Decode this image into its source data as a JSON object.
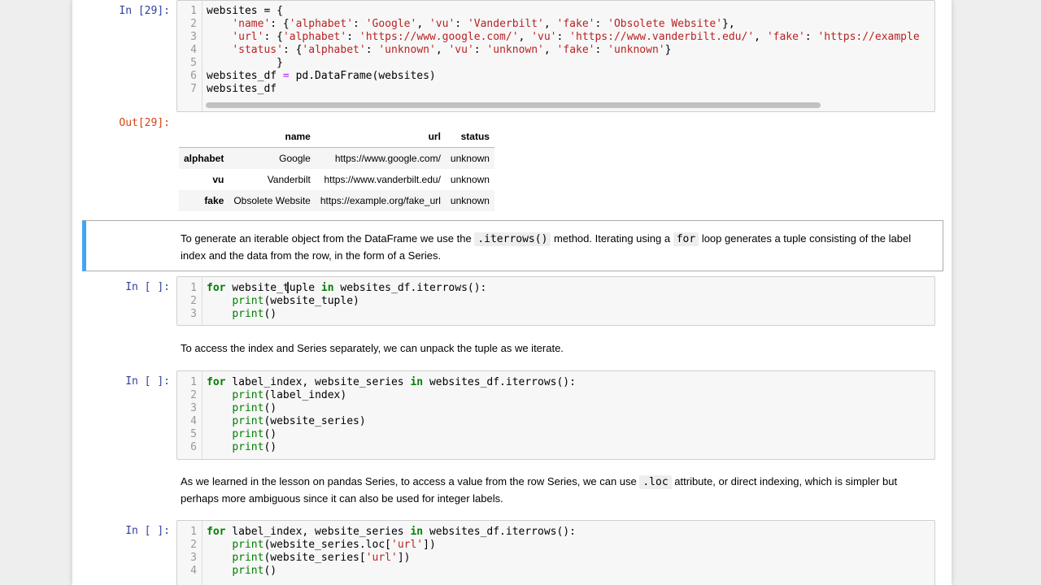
{
  "cells": {
    "c29": {
      "prompt": "In [29]:",
      "lines": [
        [
          [
            "plain",
            "websites = {"
          ]
        ],
        [
          [
            "plain",
            "    "
          ],
          [
            "str",
            "'name'"
          ],
          [
            "plain",
            ": {"
          ],
          [
            "str",
            "'alphabet'"
          ],
          [
            "plain",
            ": "
          ],
          [
            "str",
            "'Google'"
          ],
          [
            "plain",
            ", "
          ],
          [
            "str",
            "'vu'"
          ],
          [
            "plain",
            ": "
          ],
          [
            "str",
            "'Vanderbilt'"
          ],
          [
            "plain",
            ", "
          ],
          [
            "str",
            "'fake'"
          ],
          [
            "plain",
            ": "
          ],
          [
            "str",
            "'Obsolete Website'"
          ],
          [
            "plain",
            "},"
          ]
        ],
        [
          [
            "plain",
            "    "
          ],
          [
            "str",
            "'url'"
          ],
          [
            "plain",
            ": {"
          ],
          [
            "str",
            "'alphabet'"
          ],
          [
            "plain",
            ": "
          ],
          [
            "str",
            "'https://www.google.com/'"
          ],
          [
            "plain",
            ", "
          ],
          [
            "str",
            "'vu'"
          ],
          [
            "plain",
            ": "
          ],
          [
            "str",
            "'https://www.vanderbilt.edu/'"
          ],
          [
            "plain",
            ", "
          ],
          [
            "str",
            "'fake'"
          ],
          [
            "plain",
            ": "
          ],
          [
            "str",
            "'https://example"
          ]
        ],
        [
          [
            "plain",
            "    "
          ],
          [
            "str",
            "'status'"
          ],
          [
            "plain",
            ": {"
          ],
          [
            "str",
            "'alphabet'"
          ],
          [
            "plain",
            ": "
          ],
          [
            "str",
            "'unknown'"
          ],
          [
            "plain",
            ", "
          ],
          [
            "str",
            "'vu'"
          ],
          [
            "plain",
            ": "
          ],
          [
            "str",
            "'unknown'"
          ],
          [
            "plain",
            ", "
          ],
          [
            "str",
            "'fake'"
          ],
          [
            "plain",
            ": "
          ],
          [
            "str",
            "'unknown'"
          ],
          [
            "plain",
            "}"
          ]
        ],
        [
          [
            "plain",
            "           }"
          ]
        ],
        [
          [
            "plain",
            "websites_df "
          ],
          [
            "op",
            "="
          ],
          [
            "plain",
            " pd.DataFrame(websites)"
          ]
        ],
        [
          [
            "plain",
            "websites_df"
          ]
        ]
      ]
    },
    "out29": {
      "prompt": "Out[29]:",
      "columns": [
        "name",
        "url",
        "status"
      ],
      "rows": [
        {
          "index": "alphabet",
          "values": [
            "Google",
            "https://www.google.com/",
            "unknown"
          ]
        },
        {
          "index": "vu",
          "values": [
            "Vanderbilt",
            "https://www.vanderbilt.edu/",
            "unknown"
          ]
        },
        {
          "index": "fake",
          "values": [
            "Obsolete Website",
            "https://example.org/fake_url",
            "unknown"
          ]
        }
      ]
    },
    "md1": {
      "t1": "To generate an iterable object from the DataFrame we use the ",
      "c1": ".iterrows()",
      "t2": " method. Iterating using a ",
      "c2": "for",
      "t3": " loop generates a tuple consisting of the label index and the data from the row, in the form of a Series."
    },
    "c30": {
      "prompt": "In [ ]:",
      "lines": [
        [
          [
            "kw",
            "for"
          ],
          [
            "plain",
            " website_tuple "
          ],
          [
            "kw",
            "in"
          ],
          [
            "plain",
            " websites_df.iterrows():"
          ]
        ],
        [
          [
            "plain",
            "    "
          ],
          [
            "bi",
            "print"
          ],
          [
            "plain",
            "(website_tuple)"
          ]
        ],
        [
          [
            "plain",
            "    "
          ],
          [
            "bi",
            "print"
          ],
          [
            "plain",
            "()"
          ]
        ]
      ]
    },
    "md2": {
      "text": "To access the index and Series separately, we can unpack the tuple as we iterate."
    },
    "c31": {
      "prompt": "In [ ]:",
      "lines": [
        [
          [
            "kw",
            "for"
          ],
          [
            "plain",
            " label_index, website_series "
          ],
          [
            "kw",
            "in"
          ],
          [
            "plain",
            " websites_df.iterrows():"
          ]
        ],
        [
          [
            "plain",
            "    "
          ],
          [
            "bi",
            "print"
          ],
          [
            "plain",
            "(label_index)"
          ]
        ],
        [
          [
            "plain",
            "    "
          ],
          [
            "bi",
            "print"
          ],
          [
            "plain",
            "()"
          ]
        ],
        [
          [
            "plain",
            "    "
          ],
          [
            "bi",
            "print"
          ],
          [
            "plain",
            "(website_series)"
          ]
        ],
        [
          [
            "plain",
            "    "
          ],
          [
            "bi",
            "print"
          ],
          [
            "plain",
            "()"
          ]
        ],
        [
          [
            "plain",
            "    "
          ],
          [
            "bi",
            "print"
          ],
          [
            "plain",
            "()"
          ]
        ]
      ]
    },
    "md3": {
      "t1": "As we learned in the lesson on pandas Series, to access a value from the row Series, we can use ",
      "c1": ".loc",
      "t2": " attribute, or direct indexing, which is simpler but perhaps more ambiguous since it can also be used for integer labels."
    },
    "c32": {
      "prompt": "In [ ]:",
      "lines": [
        [
          [
            "kw",
            "for"
          ],
          [
            "plain",
            " label_index, website_series "
          ],
          [
            "kw",
            "in"
          ],
          [
            "plain",
            " websites_df.iterrows():"
          ]
        ],
        [
          [
            "plain",
            "    "
          ],
          [
            "bi",
            "print"
          ],
          [
            "plain",
            "(website_series.loc["
          ],
          [
            "str",
            "'url'"
          ],
          [
            "plain",
            "])"
          ]
        ],
        [
          [
            "plain",
            "    "
          ],
          [
            "bi",
            "print"
          ],
          [
            "plain",
            "(website_series["
          ],
          [
            "str",
            "'url'"
          ],
          [
            "plain",
            "])"
          ]
        ],
        [
          [
            "plain",
            "    "
          ],
          [
            "bi",
            "print"
          ],
          [
            "plain",
            "()"
          ]
        ]
      ]
    }
  }
}
